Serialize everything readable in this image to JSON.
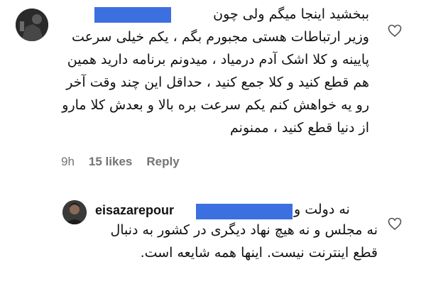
{
  "comment": {
    "avatar_icon": "user-avatar-photo",
    "text_first_line": "ببخشید اینجا میگم ولی چون",
    "text_rest": "وزیر ارتباطات هستی مجبورم بگم ، یکم خیلی سرعت پایینه و کلا اشک آدم درمیاد ، میدونم برنامه دارید همین هم قطع کنید و کلا جمع کنید ، حداقل این چند وقت آخر رو یه خواهش کنم یکم سرعت بره بالا و بعدش کلا مارو از دنیا قطع کنید ، ممنونم",
    "time": "9h",
    "likes": "15 likes",
    "reply_label": "Reply",
    "like_icon": "heart-outline-icon"
  },
  "reply": {
    "username": "eisazarepour",
    "head_tail": "نه دولت و",
    "text": "نه مجلس و نه هیچ نهاد دیگری در کشور به دنبال قطع اینترنت نیست. اینها همه شایعه است.",
    "like_icon": "heart-outline-icon"
  },
  "colors": {
    "redaction": "#3c6fe0",
    "meta_text": "#737373",
    "text": "#111111"
  }
}
